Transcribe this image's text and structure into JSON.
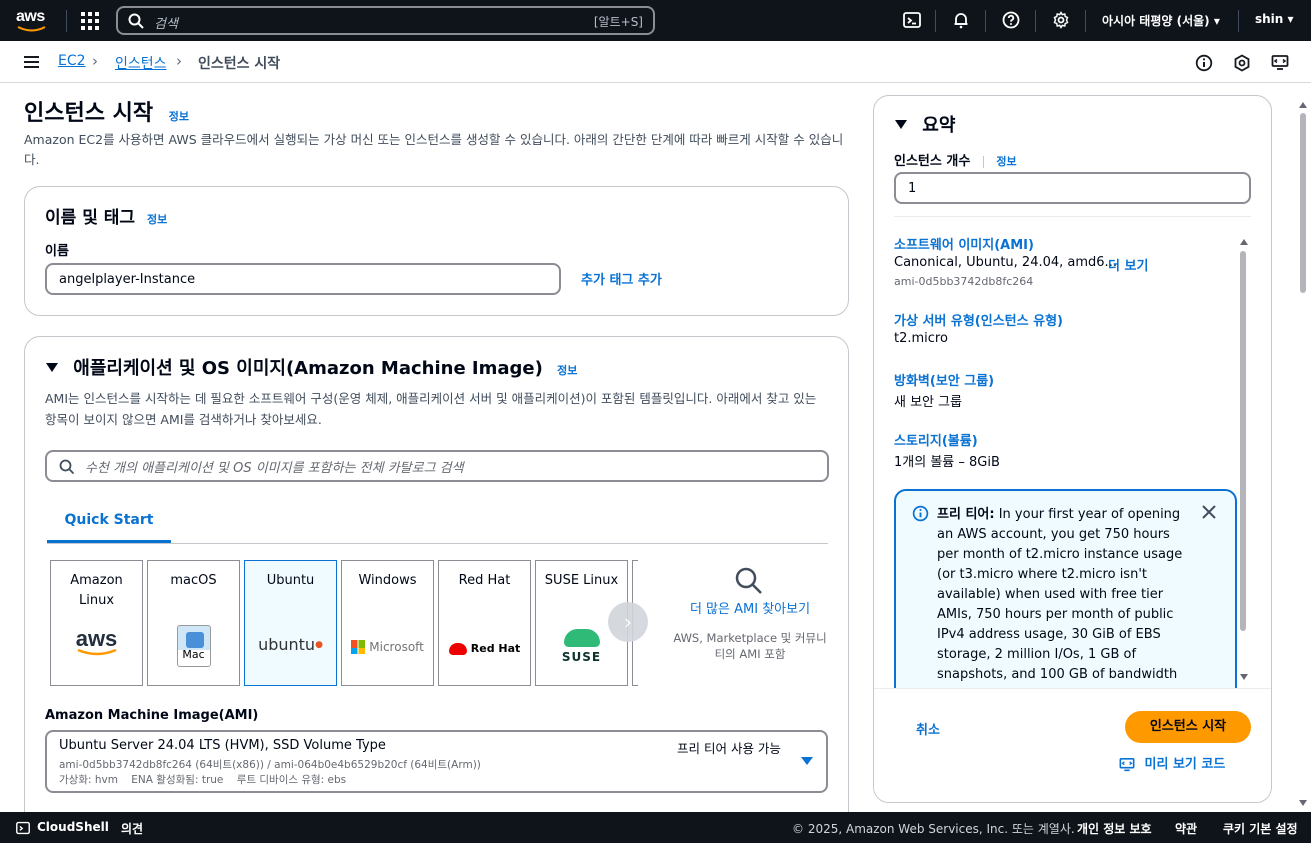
{
  "topnav": {
    "logo_text": "aws",
    "search_placeholder": "검색",
    "search_shortcut": "[알트+S]",
    "region": "아시아 태평양 (서울) ▾",
    "user": "shin ▾"
  },
  "breadcrumb": {
    "items": [
      "EC2",
      "인스턴스"
    ],
    "current": "인스턴스 시작"
  },
  "page": {
    "title": "인스턴스 시작",
    "info": "정보",
    "description": "Amazon EC2를 사용하면 AWS 클라우드에서 실행되는 가상 머신 또는 인스턴스를 생성할 수 있습니다. 아래의 간단한 단계에 따라 빠르게 시작할 수 있습니다."
  },
  "name_tags": {
    "title": "이름 및 태그",
    "info": "정보",
    "name_label": "이름",
    "name_value": "angelplayer-Instance",
    "add_tag": "추가 태그 추가"
  },
  "ami_section": {
    "title": "애플리케이션 및 OS 이미지(Amazon Machine Image)",
    "info": "정보",
    "description": "AMI는 인스턴스를 시작하는 데 필요한 소프트웨어 구성(운영 체제, 애플리케이션 서버 및 애플리케이션)이 포함된 템플릿입니다. 아래에서 찾고 있는 항목이 보이지 않으면 AMI를 검색하거나 찾아보세요.",
    "search_placeholder": "수천 개의 애플리케이션 및 OS 이미지를 포함하는 전체 카탈로그 검색",
    "tab": "Quick Start",
    "tiles": [
      {
        "label": "Amazon Linux",
        "logo": "aws"
      },
      {
        "label": "macOS",
        "logo": "Mac"
      },
      {
        "label": "Ubuntu",
        "logo": "ubuntu"
      },
      {
        "label": "Windows",
        "logo": "Microsoft"
      },
      {
        "label": "Red Hat",
        "logo": "Red Hat"
      },
      {
        "label": "SUSE Linux",
        "logo": "SUSE"
      }
    ],
    "find_more_title": "더 많은 AMI 찾아보기",
    "find_more_sub": "AWS, Marketplace 및 커뮤니티의 AMI 포함",
    "ami_label": "Amazon Machine Image(AMI)",
    "ami_name": "Ubuntu Server 24.04 LTS (HVM), SSD Volume Type",
    "ami_badge": "프리 티어 사용 가능",
    "ami_ids": "ami-0d5bb3742db8fc264 (64비트(x86)) / ami-064b0e4b6529b20cf (64비트(Arm))",
    "ami_meta": "가상화: hvm    ENA 활성화됨: true    루트 디바이스 유형: ebs"
  },
  "summary": {
    "title": "요약",
    "count_label": "인스턴스 개수",
    "info": "정보",
    "count_value": "1",
    "ami_title": "소프트웨어 이미지(AMI)",
    "ami_value": "Canonical, Ubuntu, 24.04, amd6...",
    "ami_more": "더 보기",
    "ami_id": "ami-0d5bb3742db8fc264",
    "type_title": "가상 서버 유형(인스턴스 유형)",
    "type_value": "t2.micro",
    "firewall_title": "방화벽(보안 그룹)",
    "firewall_value": "새 보안 그룹",
    "storage_title": "스토리지(볼륨)",
    "storage_value": "1개의 볼륨 – 8GiB",
    "free_tier_label": "프리 티어:",
    "free_tier_text": "In your first year of opening an AWS account, you get 750 hours per month of t2.micro instance usage (or t3.micro where t2.micro isn't available) when used with free tier AMIs, 750 hours per month of public IPv4 address usage, 30 GiB of EBS storage, 2 million I/Os, 1 GB of snapshots, and 100 GB of bandwidth",
    "cancel": "취소",
    "launch": "인스턴스 시작",
    "preview_code": "미리 보기 코드"
  },
  "footer": {
    "cloudshell": "CloudShell",
    "feedback": "의견",
    "copyright": "© 2025, Amazon Web Services, Inc. 또는 계열사.",
    "privacy": "개인 정보 보호",
    "terms": "약관",
    "cookies": "쿠키 기본 설정"
  },
  "colors": {
    "nav_bg": "#0f141a",
    "link": "#0972d3",
    "primary_button": "#ff9900"
  }
}
